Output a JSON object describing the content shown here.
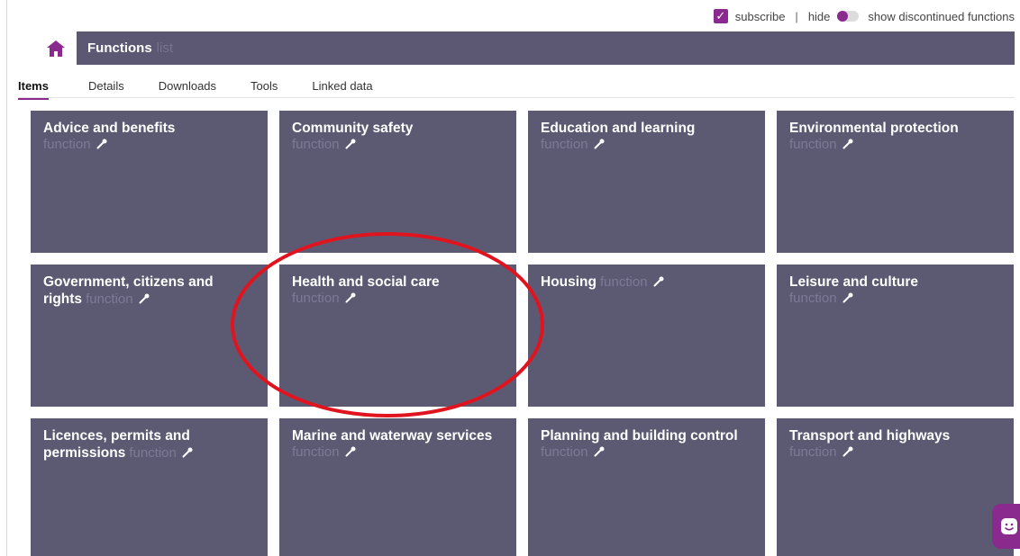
{
  "utility": {
    "subscribe_label": "subscribe",
    "separator": "|",
    "hide_label": "hide",
    "discontinued_label": "show discontinued functions",
    "subscribe_checked": true,
    "hide_toggle_on": true
  },
  "header": {
    "home_icon": "home-icon",
    "title": "Functions",
    "subtitle": "list"
  },
  "tabs": [
    {
      "label": "Items",
      "active": true
    },
    {
      "label": "Details",
      "active": false
    },
    {
      "label": "Downloads",
      "active": false
    },
    {
      "label": "Tools",
      "active": false
    },
    {
      "label": "Linked data",
      "active": false
    }
  ],
  "tiles": [
    {
      "title": "Advice and benefits",
      "type": "function",
      "icon": "wrench-icon"
    },
    {
      "title": "Community safety",
      "type": "function",
      "icon": "wrench-icon"
    },
    {
      "title": "Education and learning",
      "type": "function",
      "icon": "wrench-icon"
    },
    {
      "title": "Environmental protection",
      "type": "function",
      "icon": "wrench-icon"
    },
    {
      "title": "Government, citizens and rights",
      "type": "function",
      "icon": "wrench-icon"
    },
    {
      "title": "Health and social care",
      "type": "function",
      "icon": "wrench-icon"
    },
    {
      "title": "Housing",
      "type": "function",
      "icon": "wrench-icon"
    },
    {
      "title": "Leisure and culture",
      "type": "function",
      "icon": "wrench-icon"
    },
    {
      "title": "Licences, permits and permissions",
      "type": "function",
      "icon": "wrench-icon"
    },
    {
      "title": "Marine and waterway services",
      "type": "function",
      "icon": "wrench-icon"
    },
    {
      "title": "Planning and building control",
      "type": "function",
      "icon": "wrench-icon"
    },
    {
      "title": "Transport and highways",
      "type": "function",
      "icon": "wrench-icon"
    }
  ],
  "annotation": {
    "shape": "ellipse",
    "color": "#e0141e",
    "highlights": "Health and social care"
  },
  "chat": {
    "icon": "chat-smiley-icon"
  },
  "colors": {
    "accent": "#8b2a8e",
    "header_bg": "#5c5874",
    "tile_bg": "#5c5a73",
    "tile_type_text": "#7d7a95",
    "annotation_red": "#e0141e"
  }
}
